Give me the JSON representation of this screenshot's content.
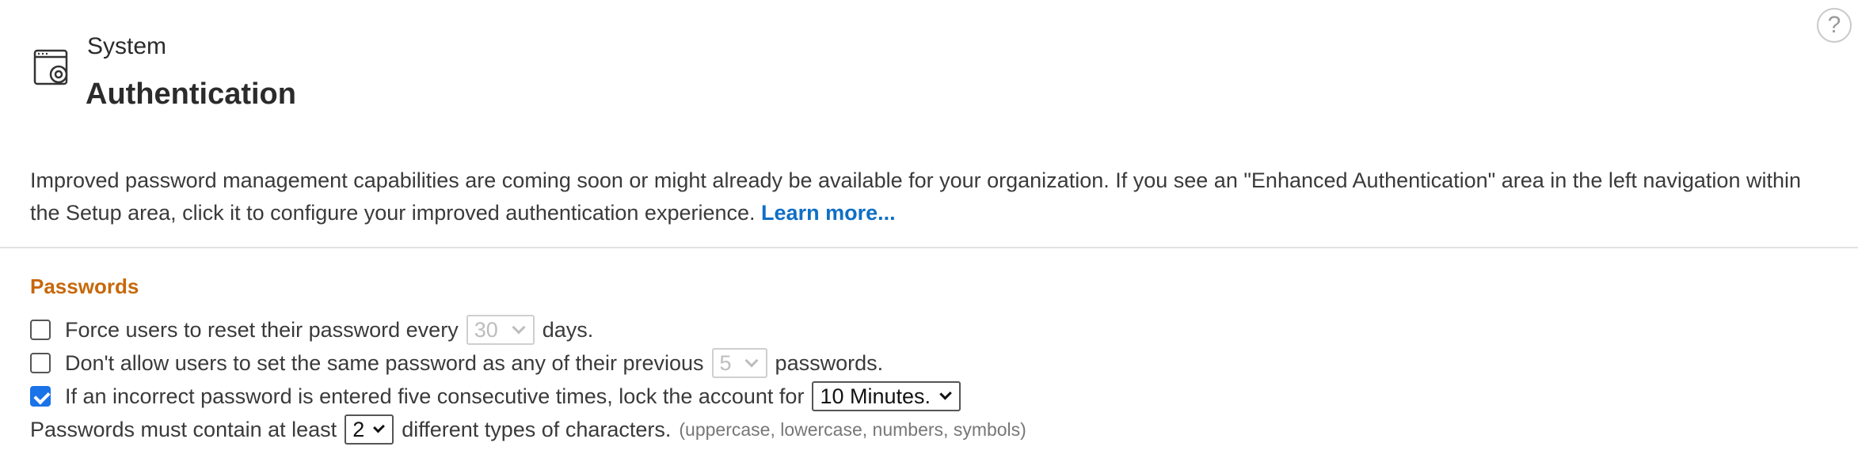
{
  "header": {
    "eyebrow": "System",
    "title": "Authentication",
    "icon": "settings-window-icon",
    "help_label": "?"
  },
  "notice": {
    "text": "Improved password management capabilities are coming soon or might already be available for your organization. If you see an \"Enhanced Authentication\" area in the left navigation within the Setup area, click it to configure your improved authentication experience.",
    "link_label": "Learn more..."
  },
  "passwords": {
    "title": "Passwords",
    "reset": {
      "checked": false,
      "before": "Force users to reset their password every",
      "value": "30",
      "after": "days."
    },
    "history": {
      "checked": false,
      "before": "Don't allow users to set the same password as any of their previous",
      "value": "5",
      "after": "passwords."
    },
    "lockout": {
      "checked": true,
      "before": "If an incorrect password is entered five consecutive times, lock the account for",
      "value": "10 Minutes."
    },
    "complexity": {
      "before": "Passwords must contain at least",
      "value": "2",
      "after": "different types of characters.",
      "hint": "(uppercase, lowercase, numbers, symbols)"
    }
  },
  "colors": {
    "section_title": "#c7680b",
    "link": "#0f6fc6",
    "checkbox_checked": "#1a73e8"
  }
}
